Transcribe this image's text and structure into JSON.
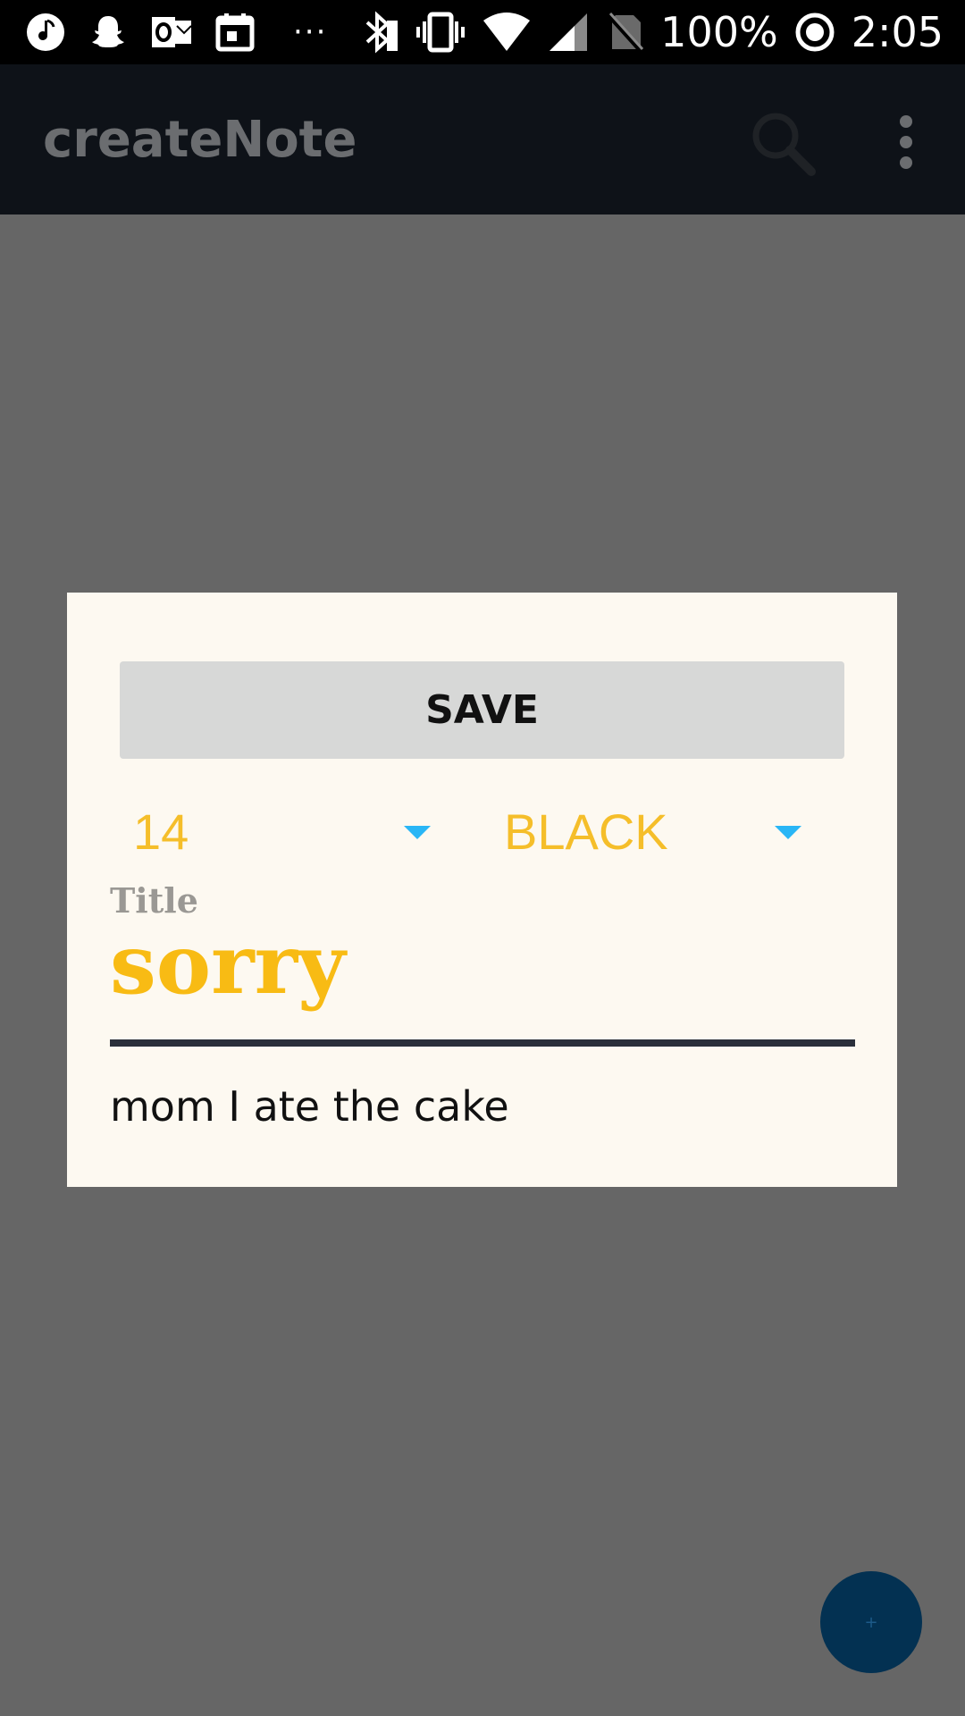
{
  "status_bar": {
    "battery": "100%",
    "time": "2:05",
    "overflow_dots": "···",
    "icons": [
      "music-icon",
      "snapchat-icon",
      "outlook-icon",
      "calendar-icon",
      "bluetooth-icon",
      "vibrate-icon",
      "wifi-icon",
      "signal-icon",
      "no-sim-icon",
      "sync-icon"
    ]
  },
  "app_bar": {
    "title": "createNote",
    "search_icon": "search-icon",
    "overflow_icon": "more-vert-icon"
  },
  "dialog": {
    "save_label": "SAVE",
    "font_size_value": "14",
    "color_value": "BLACK",
    "title_label": "Title",
    "title_value": "sorry",
    "body_value": "mom I ate the cake"
  },
  "fab": {
    "label": "+"
  },
  "colors": {
    "accent_yellow": "#f8bb14",
    "spinner_arrow": "#29b6f6",
    "fab": "#033152",
    "dialog_bg": "#fdf9f1",
    "app_bar": "#0e1218",
    "scrim": "#666666"
  }
}
